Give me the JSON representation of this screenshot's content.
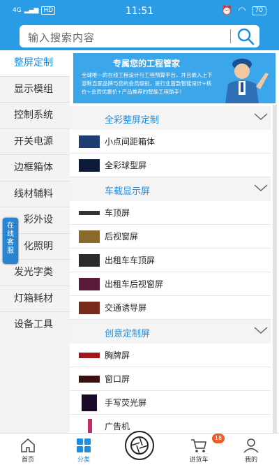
{
  "status_bar": {
    "network": "4G",
    "hd": "HD",
    "time": "11:51",
    "battery": "70"
  },
  "search": {
    "placeholder": "输入搜索内容"
  },
  "sidebar": {
    "items": [
      {
        "label": "整屏定制",
        "active": true
      },
      {
        "label": "显示模组"
      },
      {
        "label": "控制系统"
      },
      {
        "label": "开关电源"
      },
      {
        "label": "边框箱体"
      },
      {
        "label": "线材辅料"
      },
      {
        "label": "彩外设"
      },
      {
        "label": "化照明"
      },
      {
        "label": "发光字类"
      },
      {
        "label": "灯箱耗材"
      },
      {
        "label": "设备工具"
      }
    ]
  },
  "float_service": {
    "label": "在线客服"
  },
  "banner": {
    "title": "专属您的工程管家",
    "desc": "全球唯一的在线工程设计与工程预算平台，并且嵌入上下游数百家品牌与您的会员级别，是行业首款智能设计+核价+会员优惠价+产品推荐的智能工程助手！"
  },
  "sections": [
    {
      "title": "全彩整屏定制",
      "items": [
        "小点间距箱体",
        "全彩球型屏"
      ]
    },
    {
      "title": "车载显示屏",
      "items": [
        "车顶屏",
        "后视窗屏",
        "出租车车顶屏",
        "出租车后视窗屏",
        "交通诱导屏"
      ]
    },
    {
      "title": "创意定制屏",
      "items": [
        "胸牌屏",
        "窗口屏",
        "手写荧光屏",
        "广告机"
      ]
    }
  ],
  "tabbar": {
    "home": "首页",
    "category": "分类",
    "cart": "进货车",
    "cart_badge": "18",
    "mine": "我的"
  },
  "colors": {
    "primary": "#2a9ce6",
    "accent_text": "#1a8ee0",
    "badge": "#f05a28"
  }
}
